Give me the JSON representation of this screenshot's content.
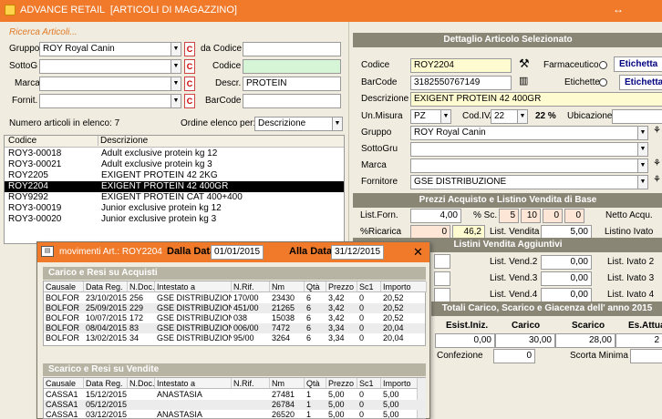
{
  "window": {
    "title": "ADVANCE RETAIL  [ARTICOLI DI MAGAZZINO]",
    "ctrl": "↔"
  },
  "search": {
    "legend": "Ricerca Articoli...",
    "gruppo_label": "Gruppo",
    "gruppo_value": "ROY Royal Canin",
    "sottog_label": "SottoG",
    "sottog_value": "",
    "marca_label": "Marca",
    "marca_value": "",
    "fornit_label": "Fornit.",
    "fornit_value": "",
    "c_label": "C",
    "dacodice_label": "da Codice",
    "dacodice_value": "",
    "codice_label": "Codice",
    "codice_value": "",
    "descr_label": "Descr.",
    "descr_value": "PROTEIN",
    "barcode_label": "BarCode",
    "barcode_value": ""
  },
  "list": {
    "count_label": "Numero articoli in elenco: 7",
    "order_label": "Ordine elenco per:",
    "order_value": "Descrizione",
    "col_codice": "Codice",
    "col_descrizione": "Descrizione",
    "rows": [
      {
        "code": "ROY3-00018",
        "desc": "Adult exclusive protein kg 12"
      },
      {
        "code": "ROY3-00021",
        "desc": "Adult exclusive protein kg 3"
      },
      {
        "code": "ROY2205",
        "desc": "EXIGENT PROTEIN 42 2KG"
      },
      {
        "code": "ROY2204",
        "desc": "EXIGENT PROTEIN 42 400GR"
      },
      {
        "code": "ROY9292",
        "desc": "EXIGENT PROTEIN CAT 400+400"
      },
      {
        "code": "ROY3-00019",
        "desc": "Junior exclusive protein kg 12"
      },
      {
        "code": "ROY3-00020",
        "desc": "Junior exclusive protein kg 3"
      }
    ]
  },
  "detail": {
    "header": "Dettaglio Articolo Selezionato",
    "codice_label": "Codice",
    "codice_value": "ROY2204",
    "farmaceutico_label": "Farmaceutico",
    "etichetta_btn": "Etichetta",
    "barcode_label": "BarCode",
    "barcode_value": "3182550767149",
    "etichette_label": "Etichette",
    "etichetta_btn2": "Etichetta E",
    "descrizione_label": "Descrizione",
    "descrizione_value": "EXIGENT PROTEIN 42 400GR",
    "unmisura_label": "Un.Misura",
    "unmisura_value": "PZ",
    "codiva_label": "Cod.IVA",
    "codiva_value": "22",
    "iva_pct": "22 %",
    "ubicazione_label": "Ubicazione",
    "gruppo_label": "Gruppo",
    "gruppo_value": "ROY Royal Canin",
    "sottogru_label": "SottoGru",
    "sottogru_value": "",
    "marca_label": "Marca",
    "marca_value": "",
    "fornitore_label": "Fornitore",
    "fornitore_value": "GSE DISTRIBUZIONE"
  },
  "prices": {
    "header": "Prezzi Acquisto e Listino Vendita di Base",
    "listforn_label": "List.Forn.",
    "listforn_value": "4,00",
    "sc_label": "% Sc.",
    "sc1": "5",
    "sc2": "10",
    "sc3": "0",
    "sc4": "0",
    "netto_label": "Netto Acqu.",
    "ricarica_label": "%Ricarica",
    "ricarica1": "0",
    "ricarica2": "46,2",
    "listvendita_label": "List. Vendita",
    "listvendita_value": "5,00",
    "listinoivato_label": "Listino Ivato"
  },
  "listini": {
    "header": "Listini Vendita Aggiuntivi",
    "vend2_label": "List. Vend.2",
    "vend2_value": "0,00",
    "vend3_label": "List. Vend.3",
    "vend3_value": "0,00",
    "vend4_label": "List. Vend.4",
    "vend4_value": "0,00",
    "ivato2_label": "List. Ivato 2",
    "ivato3_label": "List. Ivato 3",
    "ivato4_label": "List. Ivato 4"
  },
  "totali": {
    "header": "Totali Carico, Scarico e Giacenza dell' anno 2015",
    "col1": "Esist.Iniz.",
    "col2": "Carico",
    "col3": "Scarico",
    "col4": "Es.Attua",
    "val1": "0,00",
    "val2": "30,00",
    "val3": "28,00",
    "val4": "2",
    "confezione_label": "Confezione",
    "confezione_value": "0",
    "scorta_label": "Scorta Minima"
  },
  "movimenti": {
    "title": "movimenti Art.: ROY2204",
    "dalla_label": "Dalla Data",
    "dalla_value": "01/01/2015",
    "alla_label": "Alla Data",
    "alla_value": "31/12/2015",
    "close": "✕",
    "carico_header": "Carico e Resi su Acquisti",
    "scarico_header": "Scarico e Resi su Vendite",
    "cols": [
      "Causale",
      "Data Reg.",
      "N.Doc.",
      "Intestato a",
      "N.Rif.",
      "Nm",
      "Qtà",
      "Prezzo",
      "Sc1",
      "Importo"
    ],
    "carico_rows": [
      [
        "BOLFOR",
        "23/10/2015",
        "256",
        "GSE  DISTRIBUZIONE",
        "170/00",
        "23430",
        "6",
        "3,42",
        "0",
        "20,52"
      ],
      [
        "BOLFOR",
        "25/09/2015",
        "229",
        "GSE  DISTRIBUZIONE",
        "451/00",
        "21265",
        "6",
        "3,42",
        "0",
        "20,52"
      ],
      [
        "BOLFOR",
        "10/07/2015",
        "172",
        "GSE  DISTRIBUZIONE",
        "038",
        "15038",
        "6",
        "3,42",
        "0",
        "20,52"
      ],
      [
        "BOLFOR",
        "08/04/2015",
        "83",
        "GSE  DISTRIBUZIONE",
        "006/00",
        "7472",
        "6",
        "3,34",
        "0",
        "20,04"
      ],
      [
        "BOLFOR",
        "13/02/2015",
        "34",
        "GSE  DISTRIBUZIONE",
        "95/00",
        "3264",
        "6",
        "3,34",
        "0",
        "20,04"
      ]
    ],
    "scarico_rows": [
      [
        "CASSA1",
        "15/12/2015",
        "",
        "ANASTASIA",
        "",
        "27481",
        "1",
        "5,00",
        "0",
        "5,00"
      ],
      [
        "CASSA1",
        "05/12/2015",
        "",
        "",
        "",
        "26784",
        "1",
        "5,00",
        "0",
        "5,00"
      ],
      [
        "CASSA1",
        "03/12/2015",
        "",
        "ANASTASIA",
        "",
        "26520",
        "1",
        "5,00",
        "0",
        "5,00"
      ]
    ]
  }
}
